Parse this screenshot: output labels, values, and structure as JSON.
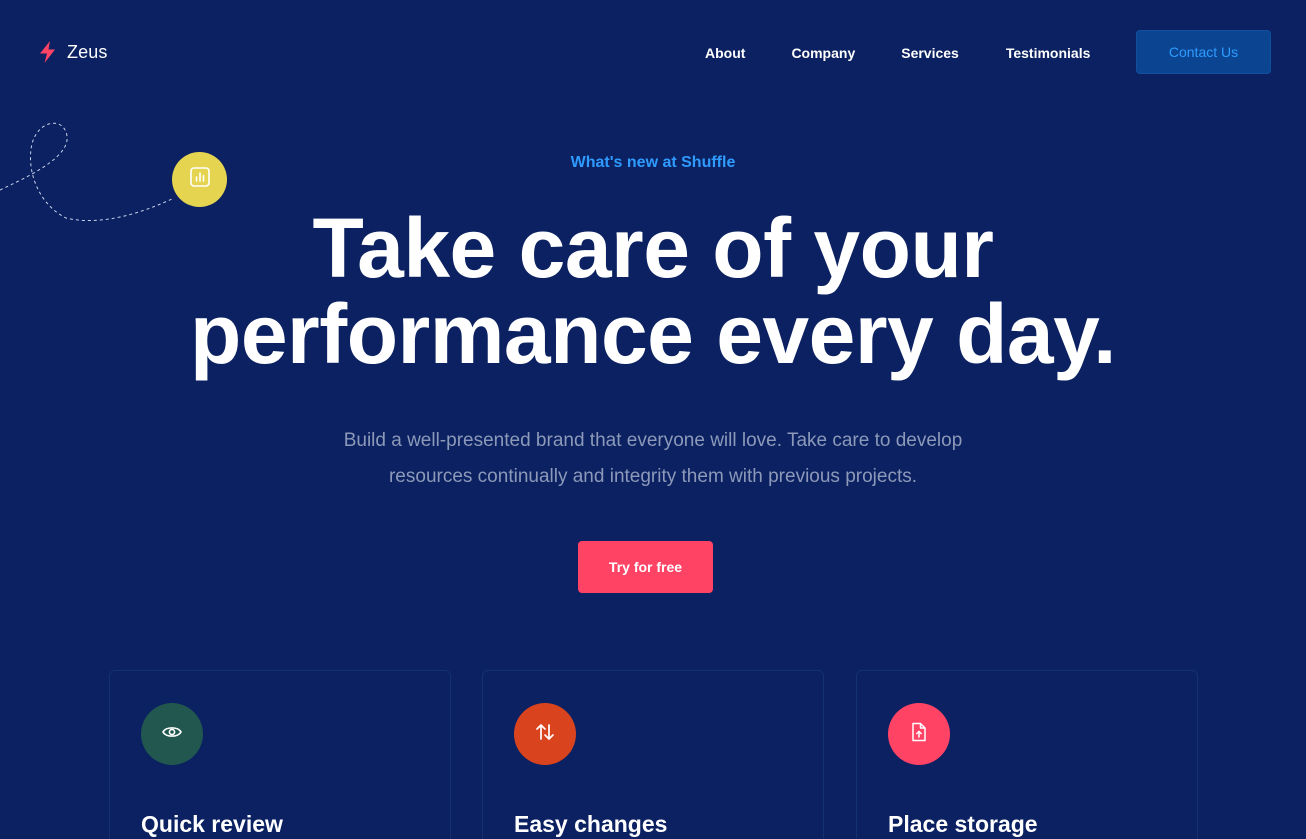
{
  "colors": {
    "background": "#0b2161",
    "accent_blue": "#2f9bff",
    "accent_red": "#ff4365",
    "badge_yellow": "#e5d44f",
    "muted_text": "#8c99b9",
    "contact_button_bg": "#0b4592"
  },
  "header": {
    "logo": {
      "icon": "lightning-bolt-icon",
      "text": "Zeus"
    },
    "nav": [
      "About",
      "Company",
      "Services",
      "Testimonials"
    ],
    "contact_label": "Contact Us"
  },
  "hero": {
    "badge_icon": "bar-chart-icon",
    "eyebrow": "What's new at Shuffle",
    "title_line1": "Take care of your",
    "title_line2": "performance every day.",
    "desc_line1": "Build a well-presented brand that everyone will love. Take care to develop",
    "desc_line2": "resources continually and integrity them with previous projects.",
    "cta_label": "Try for free"
  },
  "features": [
    {
      "icon": "eye-icon",
      "icon_color": "#21574f",
      "title": "Quick review"
    },
    {
      "icon": "arrows-up-down-icon",
      "icon_color": "#d9441e",
      "title": "Easy changes"
    },
    {
      "icon": "file-upload-icon",
      "icon_color": "#ff4365",
      "title": "Place storage"
    }
  ]
}
